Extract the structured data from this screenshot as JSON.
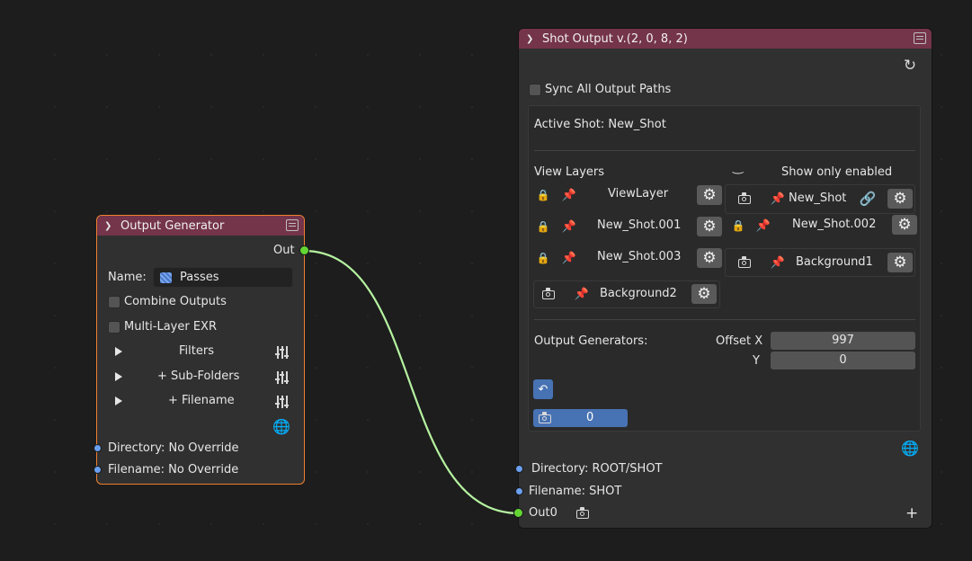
{
  "colors": {
    "header": "#74344a",
    "wire": "#b5f2a0",
    "socket_blue": "#6aa0f0",
    "socket_green": "#63d633",
    "selection": "#f08030"
  },
  "output_generator": {
    "title": "Output Generator",
    "out_label": "Out",
    "name_label": "Name:",
    "name_value": "Passes",
    "combine_outputs": "Combine Outputs",
    "multi_layer": "Multi-Layer EXR",
    "filters": "Filters",
    "sub_folders": "+ Sub-Folders",
    "filename_row": "+ Filename",
    "directory": "Directory: No Override",
    "filename": "Filename: No Override",
    "icons": [
      "chevron-down-icon",
      "node-menu-icon",
      "image-icon",
      "sliders-icon",
      "globe-icon",
      "play-triangle-icon"
    ]
  },
  "shot_output": {
    "title": "Shot Output v.(2, 0, 8, 2)",
    "sync_label": "Sync All Output Paths",
    "active_shot": "Active Shot: New_Shot",
    "view_layers": "View Layers",
    "show_only_enabled": "Show only enabled",
    "layers": [
      {
        "name": "ViewLayer"
      },
      {
        "name": "New_Shot.001"
      },
      {
        "name": "New_Shot.003"
      },
      {
        "name": "Background2"
      }
    ],
    "right_layers": [
      {
        "name": "New_Shot"
      },
      {
        "name": "New_Shot.002"
      },
      {
        "name": "Background1"
      }
    ],
    "output_generators": "Output Generators:",
    "offset_x_label": "Offset X",
    "offset_x_value": "997",
    "y_label": "Y",
    "y_value": "0",
    "camera_value": "0",
    "directory": "Directory: ROOT/SHOT",
    "filename": "Filename: SHOT",
    "out0": "Out0",
    "add": "+",
    "icons": [
      "refresh-icon",
      "camera-icon",
      "pin-icon",
      "gear-icon",
      "link-icon",
      "globe-icon",
      "eye-toggle-icon"
    ]
  }
}
